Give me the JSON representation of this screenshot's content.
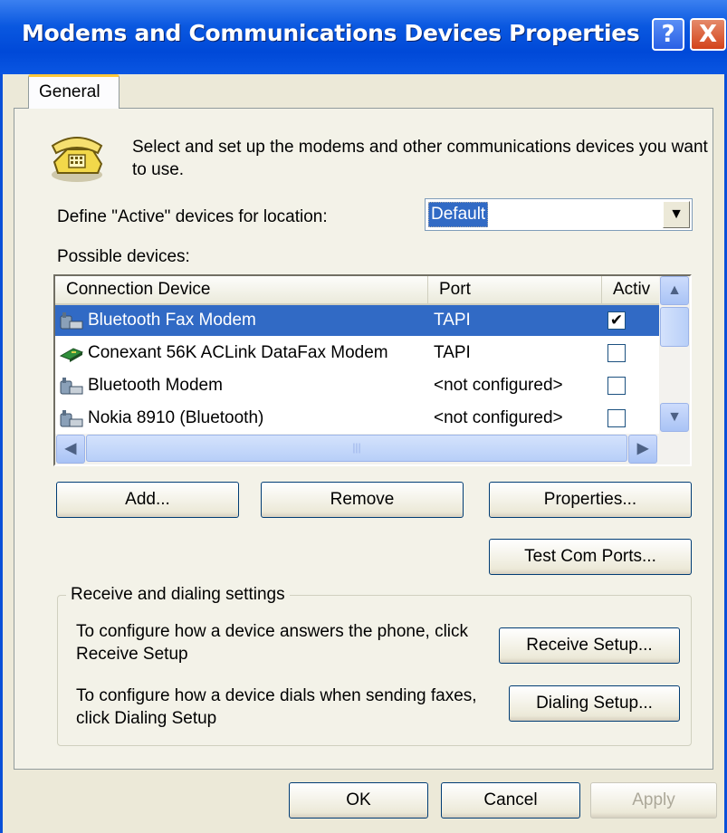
{
  "window": {
    "title": "Modems and Communications Devices Properties",
    "help_glyph": "?",
    "close_glyph": "X"
  },
  "tabs": [
    {
      "label": "General"
    }
  ],
  "intro_text": "Select and set up the modems and other communications devices you want to use.",
  "location": {
    "label": "Define \"Active\" devices for location:",
    "selected": "Default"
  },
  "devices": {
    "label": "Possible devices:",
    "columns": [
      "Connection Device",
      "Port",
      "Activ"
    ],
    "rows": [
      {
        "name": "Bluetooth Fax Modem",
        "port": "TAPI",
        "active": true,
        "selected": true,
        "icon": "bluetooth-modem-icon"
      },
      {
        "name": "Conexant 56K ACLink DataFax Modem",
        "port": "TAPI",
        "active": false,
        "selected": false,
        "icon": "modem-card-icon"
      },
      {
        "name": "Bluetooth Modem",
        "port": "<not configured>",
        "active": false,
        "selected": false,
        "icon": "bluetooth-modem-icon"
      },
      {
        "name": "Nokia 8910 (Bluetooth)",
        "port": "<not configured>",
        "active": false,
        "selected": false,
        "icon": "bluetooth-modem-icon"
      }
    ]
  },
  "buttons": {
    "add": "Add...",
    "remove": "Remove",
    "properties": "Properties...",
    "test_ports": "Test Com Ports..."
  },
  "receive_group": {
    "title": "Receive and dialing settings",
    "receive_text": "To configure how a device answers the phone, click Receive Setup",
    "receive_button": "Receive Setup...",
    "dial_text": "To configure how a device dials when sending faxes, click Dialing Setup",
    "dial_button": "Dialing Setup..."
  },
  "footer": {
    "ok": "OK",
    "cancel": "Cancel",
    "apply": "Apply"
  }
}
